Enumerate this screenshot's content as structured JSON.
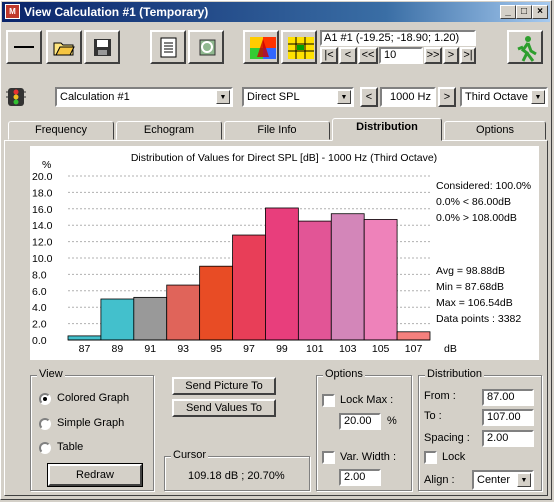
{
  "window": {
    "title": "View Calculation #1 (Temporary)",
    "app_icon": "app-logo-icon",
    "controls": [
      "minimize-icon",
      "maximize-icon",
      "close-icon"
    ]
  },
  "toolbar": {
    "tools": [
      "line-icon",
      "open-folder-icon",
      "save-disk-icon",
      "document-icon",
      "refresh-icon",
      "color-map-icon",
      "grid-map-icon"
    ],
    "position_readout": "A1 #1  (-19.25; -18.90; 1.20)",
    "nav_buttons": [
      "|<",
      "<",
      "<<",
      ">>",
      ">",
      ">|"
    ],
    "nav_value": "10",
    "exit_icon": "running-man-icon"
  },
  "selector_row": {
    "traffic_light_icon": "traffic-light-icon",
    "calculation": "Calculation #1",
    "measure": "Direct SPL",
    "prev_label": "<",
    "frequency": "1000 Hz",
    "next_label": ">",
    "band": "Third Octave"
  },
  "tabs": [
    {
      "label": "Frequency"
    },
    {
      "label": "Echogram"
    },
    {
      "label": "File Info"
    },
    {
      "label": "Distribution",
      "active": true
    },
    {
      "label": "Options"
    }
  ],
  "chart_data": {
    "type": "bar",
    "title": "Distribution of Values for Direct SPL [dB] - 1000 Hz (Third Octave)",
    "ylabel": "%",
    "xlabel": "dB",
    "ylim": [
      0,
      20
    ],
    "yticks": [
      "0.0",
      "2.0",
      "4.0",
      "6.0",
      "8.0",
      "10.0",
      "12.0",
      "14.0",
      "16.0",
      "18.0",
      "20.0"
    ],
    "x_tick_labels": [
      "87",
      "89",
      "91",
      "93",
      "95",
      "97",
      "99",
      "101",
      "103",
      "105",
      "107"
    ],
    "values": [
      0.5,
      5.0,
      5.2,
      6.7,
      9.0,
      12.8,
      16.1,
      14.5,
      15.4,
      14.7,
      1.0
    ],
    "colors": [
      "#43c0cc",
      "#43c0cc",
      "#999999",
      "#e0645a",
      "#e84c25",
      "#e83e58",
      "#e83e7c",
      "#e25596",
      "#d386b9",
      "#ee82ba",
      "#f5807d"
    ],
    "grid": true,
    "stats_top": [
      "Considered: 100.0%",
      "0.0%  < 86.00dB",
      "0.0%  > 108.00dB"
    ],
    "stats_bottom": [
      "Avg = 98.88dB",
      "Min = 87.68dB",
      "Max = 106.54dB",
      "Data points : 3382"
    ]
  },
  "view_group": {
    "legend": "View",
    "options": [
      {
        "label": "Colored Graph",
        "selected": true
      },
      {
        "label": "Simple Graph",
        "selected": false
      },
      {
        "label": "Table",
        "selected": false
      }
    ],
    "redraw_label": "Redraw"
  },
  "actions": {
    "send_picture": "Send Picture To",
    "send_values": "Send Values To"
  },
  "cursor": {
    "legend": "Cursor",
    "value": "109.18 dB ; 20.70%"
  },
  "options_group": {
    "legend": "Options",
    "lock_max_label": "Lock Max :",
    "lock_max_value": "20.00",
    "percent_unit": "%",
    "var_width_label": "Var. Width :",
    "var_width_value": "2.00"
  },
  "distribution_group": {
    "legend": "Distribution",
    "from_label": "From :",
    "from_value": "87.00",
    "to_label": "To :",
    "to_value": "107.00",
    "spacing_label": "Spacing :",
    "spacing_value": "2.00",
    "lock_label": "Lock",
    "align_label": "Align :",
    "align_value": "Center"
  }
}
